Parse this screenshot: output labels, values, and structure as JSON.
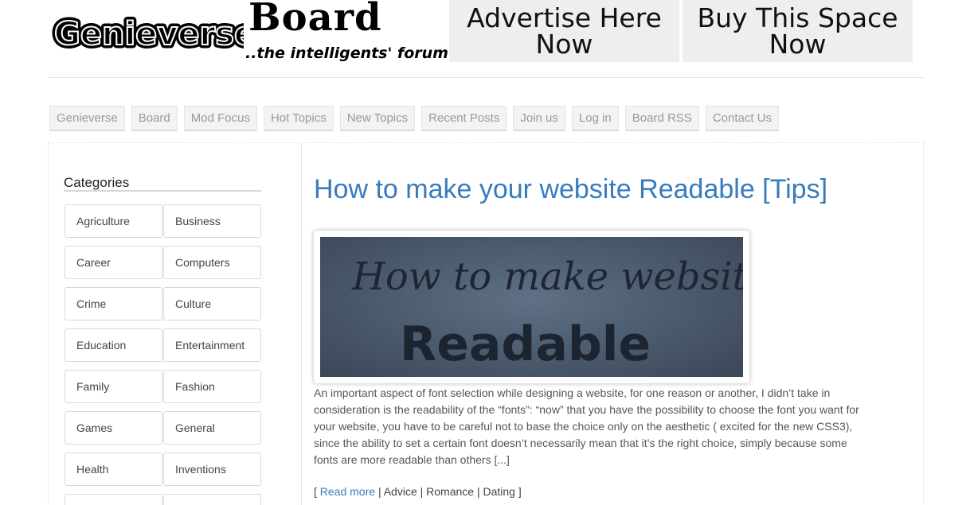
{
  "header": {
    "logo": {
      "name": "Genieverse",
      "board": "Board",
      "tagline": "..the intelligents' forum"
    },
    "ads": [
      {
        "line1": "Advertise Here",
        "line2": "Now"
      },
      {
        "line1": "Buy This Space",
        "line2": "Now"
      }
    ]
  },
  "nav": {
    "items": [
      "Genieverse",
      "Board",
      "Mod Focus",
      "Hot Topics",
      "New Topics",
      "Recent Posts",
      "Join us",
      "Log in",
      "Board RSS",
      "Contact Us"
    ]
  },
  "sidebar": {
    "title": "Categories",
    "categories": [
      "Agriculture",
      "Business",
      "Career",
      "Computers",
      "Crime",
      "Culture",
      "Education",
      "Entertainment",
      "Family",
      "Fashion",
      "Games",
      "General",
      "Health",
      "Inventions",
      "",
      ""
    ]
  },
  "post": {
    "title": "How to make your website Readable [Tips]",
    "image_text_line1": "How to make website",
    "image_text_line2": "Readable",
    "body": "An important aspect of font selection while designing a website, for one reason or another, I didn’t take in consideration is the readability of the “fonts”: “now” that you have the possibility to choose the font you want for your website, you have to be careful not to base the choice only on the aesthetic ( excited for the new CSS3), since the ability to set a certain font doesn’t necessarily mean that it’s the right choice, simply because some fonts are more readable than others [...]",
    "meta": {
      "open": "[",
      "read_more": "Read more",
      "sep": "|",
      "tags": [
        "Advice",
        "Romance",
        "Dating"
      ],
      "close": "]"
    }
  },
  "colors": {
    "link": "#3a7bbd",
    "nav_text": "#9a9a9a",
    "ad_bg": "#eeeeee"
  }
}
